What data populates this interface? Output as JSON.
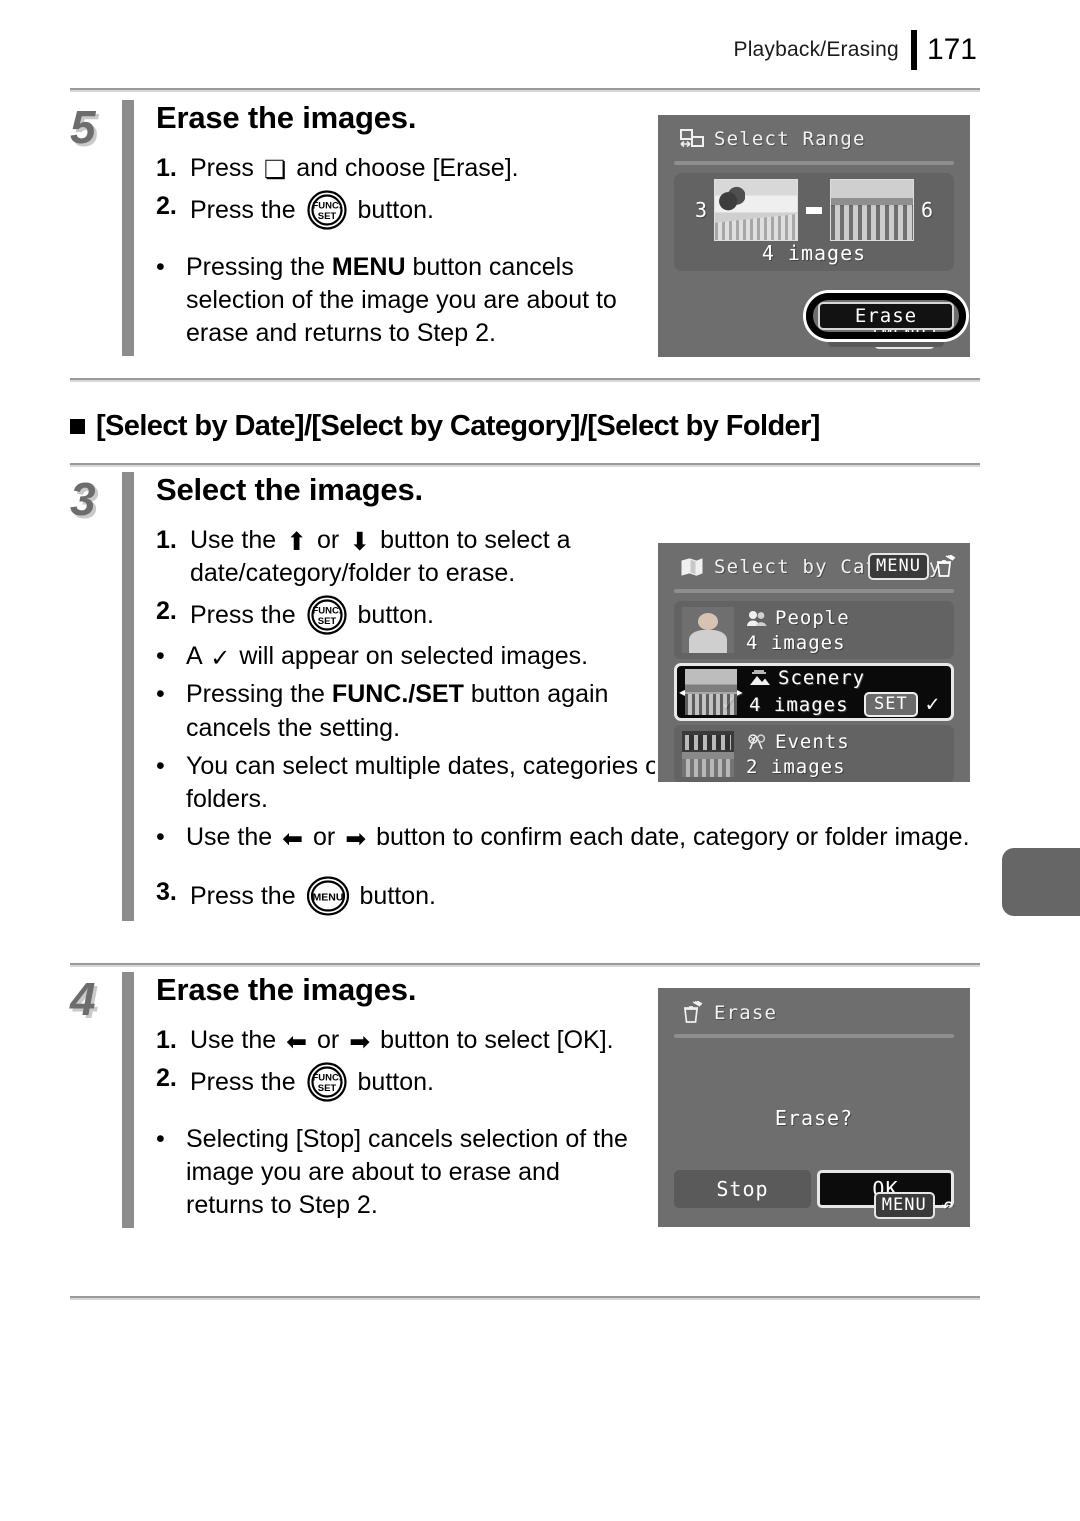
{
  "header": {
    "section_title": "Playback/Erasing",
    "page_number": "171"
  },
  "steps": [
    {
      "number": "5",
      "title": "Erase the images.",
      "lines": [
        {
          "marker": "1.",
          "pre": "Press ",
          "icon": "down-arrow",
          "post": " and choose [Erase]."
        },
        {
          "marker": "2.",
          "pre": "Press the ",
          "icon": "func-set-button",
          "post": " button."
        }
      ],
      "bullets": [
        "Pressing the MENU button cancels selection of the image you are about to erase and returns to Step 2."
      ]
    },
    {
      "number": "3",
      "title": "Select the images.",
      "lines": [
        {
          "marker": "1.",
          "pre": "Use the ",
          "icon": "up-arrow",
          "mid": " or ",
          "icon2": "down-arrow",
          "post": " button to select a date/category/folder to erase."
        },
        {
          "marker": "2.",
          "pre": "Press the ",
          "icon": "func-set-button",
          "post": " button."
        },
        {
          "marker": "3.",
          "pre": "Press the ",
          "icon": "menu-button",
          "post": " button."
        }
      ],
      "bullets": [
        "A  will appear on selected images.",
        "Pressing the FUNC./SET button again cancels the setting.",
        "You can select multiple dates, categories or folders.",
        "Use the  or  button to confirm each date, category or folder image."
      ]
    },
    {
      "number": "4",
      "title": "Erase the images.",
      "lines": [
        {
          "marker": "1.",
          "pre": "Use the ",
          "icon": "left-arrow",
          "mid": " or ",
          "icon2": "right-arrow",
          "post": " button to select [OK]."
        },
        {
          "marker": "2.",
          "pre": "Press the ",
          "icon": "func-set-button",
          "post": " button."
        }
      ],
      "bullets": [
        "Selecting [Stop] cancels selection of the image you are about to erase and returns to Step 2."
      ]
    }
  ],
  "step5": {
    "number": "5",
    "title": "Erase the images.",
    "line1_marker": "1.",
    "line1_a": "Press",
    "line1_b": "and choose [Erase].",
    "line2_marker": "2.",
    "line2_a": "Press the",
    "line2_b": "button.",
    "bullet1_a": "Pressing the ",
    "bullet1_strong": "MENU",
    "bullet1_b": " button cancels selection of the image you are about to erase and returns to Step 2."
  },
  "section_heading": {
    "text": "[Select by Date]/[Select by Category]/[Select by Folder]"
  },
  "step3": {
    "number": "3",
    "title": "Select the images.",
    "line1_marker": "1.",
    "line1_a": "Use the",
    "line1_or": "or",
    "line1_b": "button to select a date/category/folder to erase.",
    "line2_marker": "2.",
    "line2_a": "Press the",
    "line2_b": "button.",
    "bullet1_a": "A",
    "bullet1_b": "will appear on selected images.",
    "bullet2_a": "Pressing the ",
    "bullet2_strong": "FUNC./SET",
    "bullet2_b": " button again cancels the setting.",
    "bullet3": "You can select multiple dates, categories or folders.",
    "bullet4_a": "Use the",
    "bullet4_or": "or",
    "bullet4_b": "button to confirm each date, category or folder image.",
    "line3_marker": "3.",
    "line3_a": "Press the",
    "line3_b": "button."
  },
  "step4": {
    "number": "4",
    "title": "Erase the images.",
    "line1_marker": "1.",
    "line1_a": "Use the",
    "line1_or": "or",
    "line1_b": "button to select [OK].",
    "line2_marker": "2.",
    "line2_a": "Press the",
    "line2_b": "button.",
    "bullet1": "Selecting [Stop] cancels selection of the image you are about to erase and returns to Step 2."
  },
  "lcd_select_range": {
    "title": "Select Range",
    "title_icon": "select-range-icon",
    "first_index": "3",
    "last_index": "6",
    "separator": "-",
    "count_label": "4 images",
    "erase_button": "Erase",
    "menu_badge": "MENU",
    "return_arrow": "↶"
  },
  "lcd_select_category": {
    "title": "Select by Category",
    "title_icon": "category-book-icon",
    "menu_badge": "MENU",
    "menu_icon": "erase-trash-icon",
    "rows": [
      {
        "name": "People",
        "icon": "people-icon",
        "count": "4 images",
        "selected": false,
        "checked": false
      },
      {
        "name": "Scenery",
        "icon": "scenery-icon",
        "count": "4 images",
        "selected": true,
        "checked": true,
        "set_badge": "SET",
        "set_check": "✓"
      },
      {
        "name": "Events",
        "icon": "events-icon",
        "count": "2 images",
        "selected": false,
        "checked": false
      }
    ]
  },
  "lcd_erase_dialog": {
    "title": "Erase",
    "title_icon": "erase-trash-icon",
    "question": "Erase?",
    "button_stop": "Stop",
    "button_ok": "OK",
    "menu_badge": "MENU",
    "return_arrow": "↶"
  },
  "colors": {
    "lcd_background": "#6e6e6e",
    "lcd_row": "#636363",
    "selected_row": "#0a0a0a",
    "step_number": "#6d6d6d",
    "step_bar": "#8c8c8c",
    "rule": "#9a9a9a",
    "edge_tab": "#666666"
  }
}
